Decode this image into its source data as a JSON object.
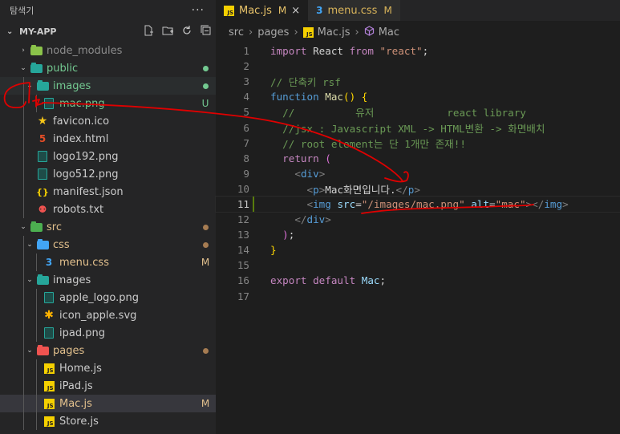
{
  "sidebar": {
    "title": "탐색기",
    "more": "···",
    "project": "MY-APP",
    "actions": [
      "new-file-icon",
      "new-folder-icon",
      "refresh-icon",
      "collapse-icon"
    ],
    "tree": [
      {
        "label": "node_modules",
        "kind": "folder",
        "icon": "folder-node-icon",
        "color": "#8bc34a",
        "depth": 1,
        "chevron": "›",
        "status": "",
        "label_color": "#8c8c8c"
      },
      {
        "label": "public",
        "kind": "folder",
        "icon": "folder-public-icon",
        "color": "#26a69a",
        "depth": 1,
        "chevron": "⌄",
        "status": "dot",
        "status_color": "#73c991",
        "label_color": "#73c991"
      },
      {
        "label": "images",
        "kind": "folder",
        "icon": "folder-images-icon",
        "color": "#26a69a",
        "depth": 2,
        "chevron": "⌄",
        "status": "dot",
        "status_color": "#73c991",
        "label_color": "#73c991",
        "highlight": true
      },
      {
        "label": "mac.png",
        "kind": "img",
        "icon": "image-file-icon",
        "depth": 3,
        "status": "U",
        "status_color": "#73c991",
        "label_color": "#73c991"
      },
      {
        "label": "favicon.ico",
        "kind": "star",
        "icon": "favicon-icon",
        "depth": 2,
        "status": ""
      },
      {
        "label": "index.html",
        "kind": "html",
        "icon": "html5-icon",
        "depth": 2,
        "status": ""
      },
      {
        "label": "logo192.png",
        "kind": "img",
        "icon": "image-file-icon",
        "depth": 2,
        "status": ""
      },
      {
        "label": "logo512.png",
        "kind": "img",
        "icon": "image-file-icon",
        "depth": 2,
        "status": ""
      },
      {
        "label": "manifest.json",
        "kind": "json",
        "icon": "json-icon",
        "depth": 2,
        "status": ""
      },
      {
        "label": "robots.txt",
        "kind": "robot",
        "icon": "robot-icon",
        "depth": 2,
        "status": ""
      },
      {
        "label": "src",
        "kind": "folder",
        "icon": "folder-src-icon",
        "color": "#4caf50",
        "depth": 1,
        "chevron": "⌄",
        "status": "dot",
        "status_color": "#a67c52",
        "label_color": "#e2c08d"
      },
      {
        "label": "css",
        "kind": "folder",
        "icon": "folder-css-icon",
        "color": "#42a5f5",
        "depth": 2,
        "chevron": "⌄",
        "status": "dot",
        "status_color": "#a67c52",
        "label_color": "#e2c08d"
      },
      {
        "label": "menu.css",
        "kind": "css",
        "icon": "css3-icon",
        "depth": 3,
        "status": "M",
        "status_color": "#e2c08d",
        "label_color": "#e2c08d"
      },
      {
        "label": "images",
        "kind": "folder",
        "icon": "folder-images-icon",
        "color": "#26a69a",
        "depth": 2,
        "chevron": "⌄",
        "status": ""
      },
      {
        "label": "apple_logo.png",
        "kind": "img",
        "icon": "image-file-icon",
        "depth": 3,
        "status": ""
      },
      {
        "label": "icon_apple.svg",
        "kind": "svg",
        "icon": "svg-icon",
        "depth": 3,
        "status": ""
      },
      {
        "label": "ipad.png",
        "kind": "img",
        "icon": "image-file-icon",
        "depth": 3,
        "status": ""
      },
      {
        "label": "pages",
        "kind": "folder",
        "icon": "folder-pages-icon",
        "color": "#ef5350",
        "depth": 2,
        "chevron": "⌄",
        "status": "dot",
        "status_color": "#a67c52",
        "label_color": "#e2c08d"
      },
      {
        "label": "Home.js",
        "kind": "js",
        "icon": "js-icon",
        "depth": 3,
        "status": ""
      },
      {
        "label": "iPad.js",
        "kind": "js",
        "icon": "js-icon",
        "depth": 3,
        "status": ""
      },
      {
        "label": "Mac.js",
        "kind": "js",
        "icon": "js-icon",
        "depth": 3,
        "status": "M",
        "status_color": "#e2c08d",
        "label_color": "#e2c08d",
        "selected": true
      },
      {
        "label": "Store.js",
        "kind": "js",
        "icon": "js-icon",
        "depth": 3,
        "status": ""
      }
    ]
  },
  "tabs": [
    {
      "name": "Mac.js",
      "status": "M",
      "icon": "js-icon",
      "active": true,
      "close": "×"
    },
    {
      "name": "menu.css",
      "status": "M",
      "icon": "css3-icon",
      "active": false
    }
  ],
  "breadcrumb": {
    "parts": [
      "src",
      "pages",
      "Mac.js",
      "Mac"
    ]
  },
  "editor": {
    "current_line": 11,
    "lines": [
      {
        "n": 1,
        "tokens": [
          [
            "kw",
            "import"
          ],
          [
            "txt",
            " React "
          ],
          [
            "kw",
            "from"
          ],
          [
            "txt",
            " "
          ],
          [
            "s",
            "\"react\""
          ],
          [
            "txt",
            ";"
          ]
        ]
      },
      {
        "n": 2,
        "tokens": []
      },
      {
        "n": 3,
        "tokens": [
          [
            "c",
            "// 단축키 rsf"
          ]
        ]
      },
      {
        "n": 4,
        "tokens": [
          [
            "k",
            "function"
          ],
          [
            "txt",
            " "
          ],
          [
            "f",
            "Mac"
          ],
          [
            "b1",
            "()"
          ],
          [
            "txt",
            " "
          ],
          [
            "b1",
            "{"
          ]
        ]
      },
      {
        "n": 5,
        "tokens": [
          [
            "c",
            "  //          유저            react library"
          ]
        ]
      },
      {
        "n": 6,
        "tokens": [
          [
            "c",
            "  //jsx : Javascript XML -> HTML변환 -> 화면배치"
          ]
        ]
      },
      {
        "n": 7,
        "tokens": [
          [
            "c",
            "  // root element는 단 1개만 존재!!"
          ]
        ]
      },
      {
        "n": 8,
        "tokens": [
          [
            "txt",
            "  "
          ],
          [
            "kw",
            "return"
          ],
          [
            "txt",
            " "
          ],
          [
            "b2",
            "("
          ]
        ]
      },
      {
        "n": 9,
        "tokens": [
          [
            "txt",
            "    "
          ],
          [
            "p",
            "<"
          ],
          [
            "t",
            "div"
          ],
          [
            "p",
            ">"
          ]
        ]
      },
      {
        "n": 10,
        "tokens": [
          [
            "txt",
            "      "
          ],
          [
            "p",
            "<"
          ],
          [
            "t",
            "p"
          ],
          [
            "p",
            ">"
          ],
          [
            "txt",
            "Mac화면입니다."
          ],
          [
            "p",
            "</"
          ],
          [
            "t",
            "p"
          ],
          [
            "p",
            ">"
          ]
        ]
      },
      {
        "n": 11,
        "tokens": [
          [
            "txt",
            "      "
          ],
          [
            "p",
            "<"
          ],
          [
            "t",
            "img"
          ],
          [
            "txt",
            " "
          ],
          [
            "a",
            "src"
          ],
          [
            "txt",
            "="
          ],
          [
            "s",
            "\"/images/mac.png\""
          ],
          [
            "txt",
            " "
          ],
          [
            "a",
            "alt"
          ],
          [
            "txt",
            "="
          ],
          [
            "s",
            "\"mac\""
          ],
          [
            "p",
            ">"
          ],
          [
            "p",
            "</"
          ],
          [
            "t",
            "img"
          ],
          [
            "p",
            ">"
          ]
        ]
      },
      {
        "n": 12,
        "tokens": [
          [
            "txt",
            "    "
          ],
          [
            "p",
            "</"
          ],
          [
            "t",
            "div"
          ],
          [
            "p",
            ">"
          ]
        ]
      },
      {
        "n": 13,
        "tokens": [
          [
            "txt",
            "  "
          ],
          [
            "b2",
            ")"
          ],
          [
            "txt",
            ";"
          ]
        ]
      },
      {
        "n": 14,
        "tokens": [
          [
            "b1",
            "}"
          ]
        ]
      },
      {
        "n": 15,
        "tokens": []
      },
      {
        "n": 16,
        "tokens": [
          [
            "kw",
            "export"
          ],
          [
            "txt",
            " "
          ],
          [
            "kw",
            "default"
          ],
          [
            "txt",
            " "
          ],
          [
            "v",
            "Mac"
          ],
          [
            "txt",
            ";"
          ]
        ]
      },
      {
        "n": 17,
        "tokens": []
      }
    ]
  },
  "annotation_color": "#e00000"
}
